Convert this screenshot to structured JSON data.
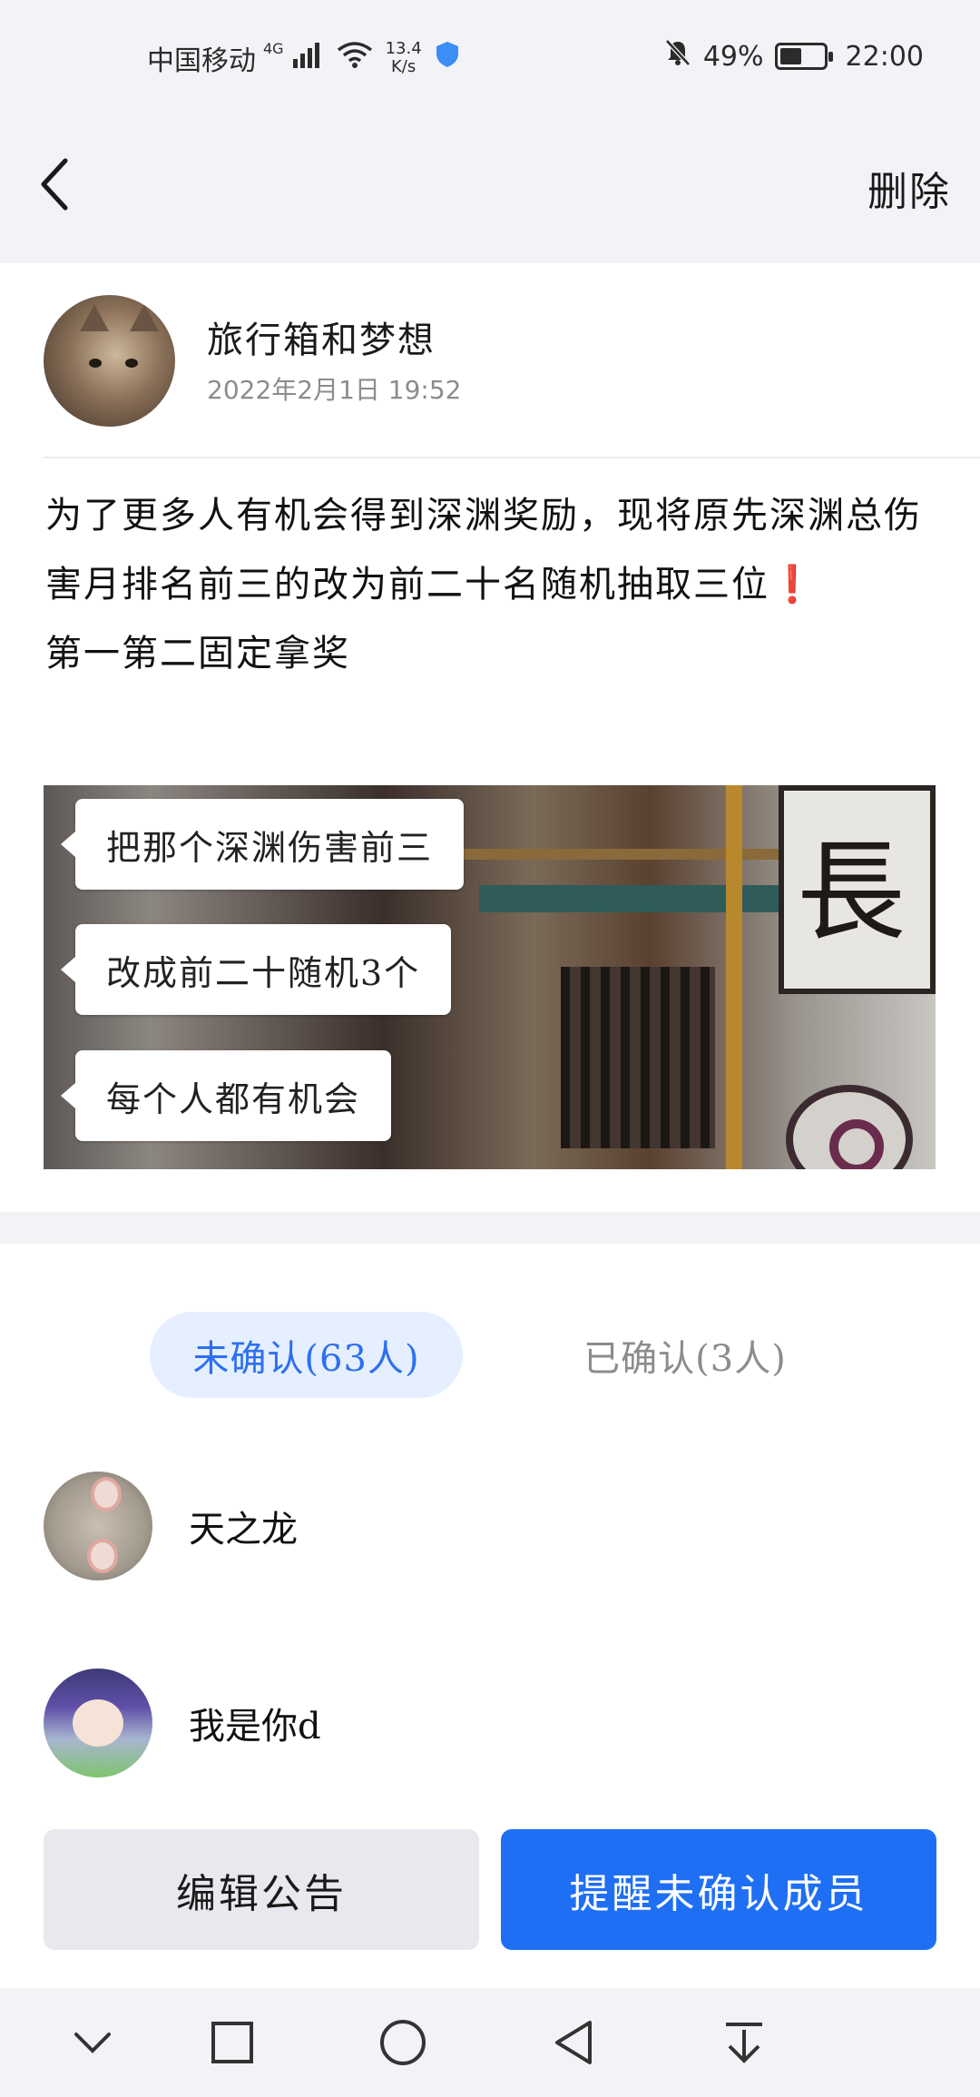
{
  "status_bar": {
    "carrier": "中国移动",
    "network": "4G",
    "speed_value": "13.4",
    "speed_unit": "K/s",
    "battery_level": "49%",
    "battery_fraction": 0.49,
    "time": "22:00"
  },
  "nav": {
    "back_icon": "chevron-left-icon",
    "delete_label": "删除"
  },
  "post": {
    "author": "旅行箱和梦想",
    "time": "2022年2月1日  19:52",
    "body_line1": "为了更多人有机会得到深渊奖励，现将原先深渊总伤害月排名前三的改为前二十名随机抽取三位",
    "exclaim": "❗",
    "body_line2": "第一第二固定拿奖",
    "image": {
      "bubble1": "把那个深渊伤害前三",
      "bubble2": "改成前二十随机3个",
      "bubble3": "每个人都有机会",
      "sign_glyph": "長"
    }
  },
  "confirm": {
    "tab_unconfirmed": "未确认(63人)",
    "tab_confirmed": "已确认(3人)",
    "members": [
      {
        "name": "天之龙"
      },
      {
        "name": "我是你d"
      }
    ]
  },
  "actions": {
    "edit_label": "编辑公告",
    "remind_label": "提醒未确认成员"
  },
  "colors": {
    "accent": "#1f6ff5",
    "tab_active_bg": "#e5efff",
    "tab_active_text": "#2d6ff0",
    "page_bg": "#f2f3f6"
  },
  "system_nav": [
    "chevron-down-icon",
    "square-icon",
    "circle-icon",
    "triangle-back-icon",
    "pull-down-icon"
  ]
}
